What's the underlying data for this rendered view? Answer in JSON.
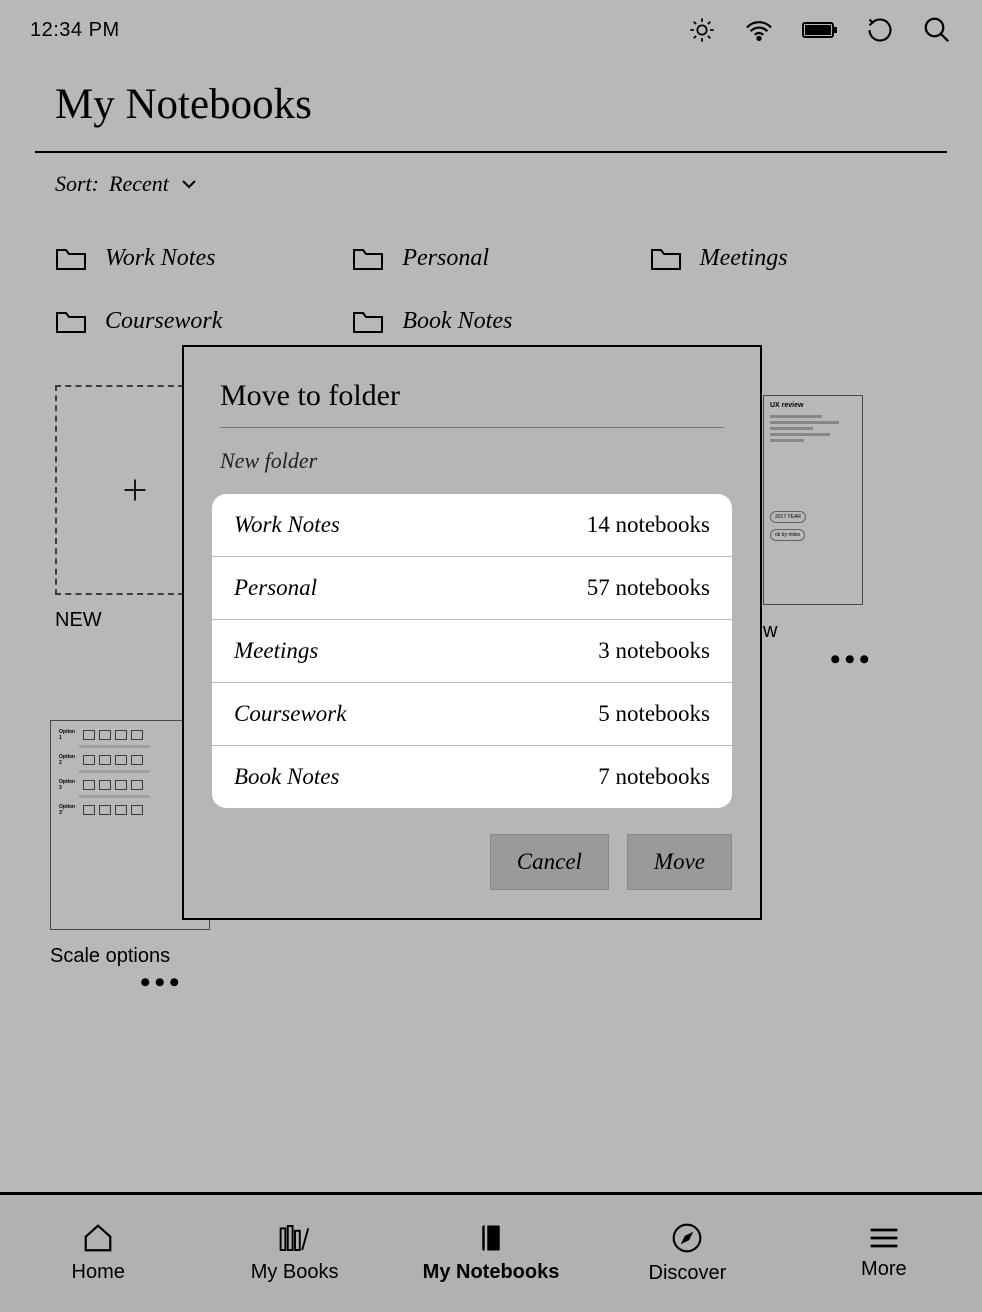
{
  "status": {
    "time": "12:34 PM"
  },
  "page": {
    "title": "My Notebooks"
  },
  "sort": {
    "prefix": "Sort:",
    "value": "Recent"
  },
  "folders_top": [
    {
      "name": "Work Notes"
    },
    {
      "name": "Personal"
    },
    {
      "name": "Meetings"
    },
    {
      "name": "Coursework"
    },
    {
      "name": "Book Notes"
    }
  ],
  "notebooks": {
    "new_label": "NEW",
    "items": [
      {
        "label": "w",
        "partial": true
      },
      {
        "label": "Scale options"
      }
    ]
  },
  "dialog": {
    "title": "Move to folder",
    "new_folder": "New folder",
    "folders": [
      {
        "name": "Work Notes",
        "count": "14 notebooks"
      },
      {
        "name": "Personal",
        "count": "57 notebooks"
      },
      {
        "name": "Meetings",
        "count": "3 notebooks"
      },
      {
        "name": "Coursework",
        "count": "5 notebooks"
      },
      {
        "name": "Book Notes",
        "count": "7 notebooks"
      }
    ],
    "cancel": "Cancel",
    "move": "Move"
  },
  "nav": {
    "home": "Home",
    "my_books": "My Books",
    "my_notebooks": "My Notebooks",
    "discover": "Discover",
    "more": "More"
  },
  "peek": {
    "header": "UX review",
    "bubble1": "2017 YEAR",
    "bubble2": "ok by miles"
  },
  "sketch": {
    "opt1": "Option 1",
    "opt2": "Option 2",
    "opt3": "Option 3",
    "opt4": "Option 3'"
  }
}
